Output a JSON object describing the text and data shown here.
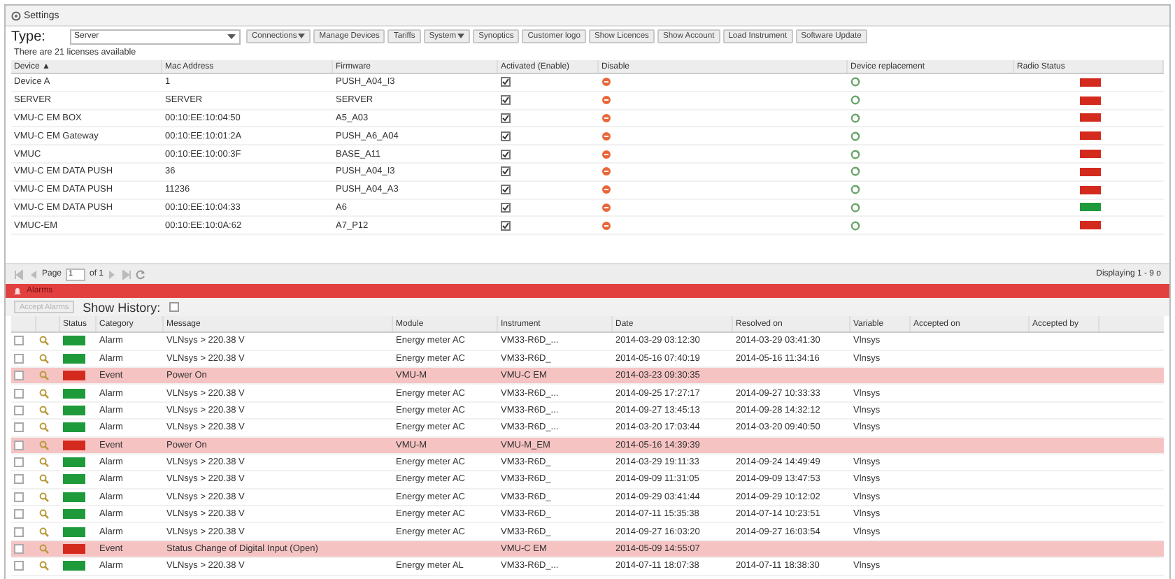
{
  "panel": {
    "title": "Settings"
  },
  "toolbar": {
    "type_label": "Type:",
    "type_value": "Server",
    "buttons": [
      {
        "label": "Connections",
        "menu": true
      },
      {
        "label": "Manage Devices",
        "menu": false
      },
      {
        "label": "Tariffs",
        "menu": false
      },
      {
        "label": "System",
        "menu": true
      },
      {
        "label": "Synoptics",
        "menu": false
      },
      {
        "label": "Customer logo",
        "menu": false
      },
      {
        "label": "Show Licences",
        "menu": false
      },
      {
        "label": "Show Account",
        "menu": false
      },
      {
        "label": "Load Instrument",
        "menu": false
      },
      {
        "label": "Software Update",
        "menu": false
      }
    ]
  },
  "license_note": "There are 21 licenses available",
  "devices": {
    "columns": [
      "Device ▲",
      "Mac Address",
      "Firmware",
      "Activated (Enable)",
      "Disable",
      "Device replacement",
      "Radio Status"
    ],
    "rows": [
      {
        "device": "Device A",
        "mac": "1",
        "firmware": "PUSH_A04_I3",
        "activated": true,
        "color": "#d42a1e"
      },
      {
        "device": "SERVER",
        "mac": "SERVER",
        "firmware": "SERVER",
        "activated": true,
        "color": "#d42a1e"
      },
      {
        "device": "VMU-C EM BOX",
        "mac": "00:10:EE:10:04:50",
        "firmware": "A5_A03",
        "activated": true,
        "color": "#d42a1e"
      },
      {
        "device": "VMU-C EM Gateway",
        "mac": "00:10:EE:10:01:2A",
        "firmware": "PUSH_A6_A04",
        "activated": true,
        "color": "#d42a1e"
      },
      {
        "device": "VMUC",
        "mac": "00:10:EE:10:00:3F",
        "firmware": "BASE_A11",
        "activated": true,
        "color": "#d42a1e"
      },
      {
        "device": "VMU-C EM DATA PUSH",
        "mac": "36",
        "firmware": "PUSH_A04_I3",
        "activated": true,
        "color": "#d42a1e"
      },
      {
        "device": "VMU-C EM DATA PUSH",
        "mac": "11236",
        "firmware": "PUSH_A04_A3",
        "activated": true,
        "color": "#d42a1e"
      },
      {
        "device": "VMU-C EM DATA PUSH",
        "mac": "00:10:EE:10:04:33",
        "firmware": "A6",
        "activated": true,
        "color": "#1e9a3a"
      },
      {
        "device": "VMUC-EM",
        "mac": "00:10:EE:10:0A:62",
        "firmware": "A7_P12",
        "activated": true,
        "color": "#d42a1e"
      }
    ],
    "pager": {
      "page_label": "Page",
      "page": "1",
      "of": "of 1",
      "display": "Displaying 1 - 9 o"
    }
  },
  "alarms": {
    "title": "Alarms",
    "accept_button": {
      "label": "Accept Alarms",
      "disabled": true
    },
    "history": {
      "label": "Show History:",
      "checked": false
    },
    "columns": [
      "Status",
      "Category",
      "Message",
      "Module",
      "Instrument",
      "Date",
      "Resolved on",
      "Variable",
      "Accepted on",
      "Accepted by"
    ],
    "rows": [
      {
        "kind": "alarm",
        "checked": false,
        "color": "#1e9a3a",
        "category": "Alarm",
        "message": "VLNsys > 220.38 V",
        "module": "Energy meter AC",
        "instrument": "VM33-R6D_...",
        "date": "2014-03-29 03:12:30",
        "resolved": "2014-03-29 03:41:30",
        "variable": "Vlnsys"
      },
      {
        "kind": "alarm",
        "checked": false,
        "color": "#1e9a3a",
        "category": "Alarm",
        "message": "VLNsys > 220.38 V",
        "module": "Energy meter AC",
        "instrument": "VM33-R6D_",
        "date": "2014-05-16 07:40:19",
        "resolved": "2014-05-16 11:34:16",
        "variable": "Vlnsys"
      },
      {
        "kind": "event",
        "checked": false,
        "color": "#d42a1e",
        "category": "Event",
        "message": "Power On",
        "module": "VMU-M",
        "instrument": "VMU-C EM",
        "date": "2014-03-23 09:30:35",
        "resolved": "",
        "variable": ""
      },
      {
        "kind": "alarm",
        "checked": false,
        "color": "#1e9a3a",
        "category": "Alarm",
        "message": "VLNsys > 220.38 V",
        "module": "Energy meter AC",
        "instrument": "VM33-R6D_...",
        "date": "2014-09-25 17:27:17",
        "resolved": "2014-09-27 10:33:33",
        "variable": "Vlnsys"
      },
      {
        "kind": "alarm",
        "checked": false,
        "color": "#1e9a3a",
        "category": "Alarm",
        "message": "VLNsys > 220.38 V",
        "module": "Energy meter AC",
        "instrument": "VM33-R6D_...",
        "date": "2014-09-27 13:45:13",
        "resolved": "2014-09-28 14:32:12",
        "variable": "Vlnsys"
      },
      {
        "kind": "alarm",
        "checked": false,
        "color": "#1e9a3a",
        "category": "Alarm",
        "message": "VLNsys > 220.38 V",
        "module": "Energy meter AC",
        "instrument": "VM33-R6D_...",
        "date": "2014-03-20 17:03:44",
        "resolved": "2014-03-20 09:40:50",
        "variable": "Vlnsys"
      },
      {
        "kind": "event",
        "checked": false,
        "color": "#d42a1e",
        "category": "Event",
        "message": "Power On",
        "module": "VMU-M",
        "instrument": "VMU-M_EM",
        "date": "2014-05-16 14:39:39",
        "resolved": "",
        "variable": ""
      },
      {
        "kind": "alarm",
        "checked": false,
        "color": "#1e9a3a",
        "category": "Alarm",
        "message": "VLNsys > 220.38 V",
        "module": "Energy meter AC",
        "instrument": "VM33-R6D_",
        "date": "2014-03-29 19:11:33",
        "resolved": "2014-09-24 14:49:49",
        "variable": "Vlnsys"
      },
      {
        "kind": "alarm",
        "checked": false,
        "color": "#1e9a3a",
        "category": "Alarm",
        "message": "VLNsys > 220.38 V",
        "module": "Energy meter AC",
        "instrument": "VM33-R6D_",
        "date": "2014-09-09 11:31:05",
        "resolved": "2014-09-09 13:47:53",
        "variable": "Vlnsys"
      },
      {
        "kind": "alarm",
        "checked": false,
        "color": "#1e9a3a",
        "category": "Alarm",
        "message": "VLNsys > 220.38 V",
        "module": "Energy meter AC",
        "instrument": "VM33-R6D_",
        "date": "2014-09-29 03:41:44",
        "resolved": "2014-09-29 10:12:02",
        "variable": "Vlnsys"
      },
      {
        "kind": "alarm",
        "checked": false,
        "color": "#1e9a3a",
        "category": "Alarm",
        "message": "VLNsys > 220.38 V",
        "module": "Energy meter AC",
        "instrument": "VM33-R6D_",
        "date": "2014-07-11 15:35:38",
        "resolved": "2014-07-14 10:23:51",
        "variable": "Vlnsys"
      },
      {
        "kind": "alarm",
        "checked": false,
        "color": "#1e9a3a",
        "category": "Alarm",
        "message": "VLNsys > 220.38 V",
        "module": "Energy meter AC",
        "instrument": "VM33-R6D_",
        "date": "2014-09-27 16:03:20",
        "resolved": "2014-09-27 16:03:54",
        "variable": "Vlnsys"
      },
      {
        "kind": "event",
        "checked": false,
        "color": "#d42a1e",
        "category": "Event",
        "message": "Status Change of Digital Input (Open)",
        "module": "",
        "instrument": "VMU-C EM",
        "date": "2014-05-09 14:55:07",
        "resolved": "",
        "variable": ""
      },
      {
        "kind": "alarm",
        "checked": false,
        "color": "#1e9a3a",
        "category": "Alarm",
        "message": "VLNsys > 220.38 V",
        "module": "Energy meter AL",
        "instrument": "VM33-R6D_...",
        "date": "2014-07-11 18:07:38",
        "resolved": "2014-07-11 18:38:30",
        "variable": "Vlnsys"
      }
    ]
  }
}
